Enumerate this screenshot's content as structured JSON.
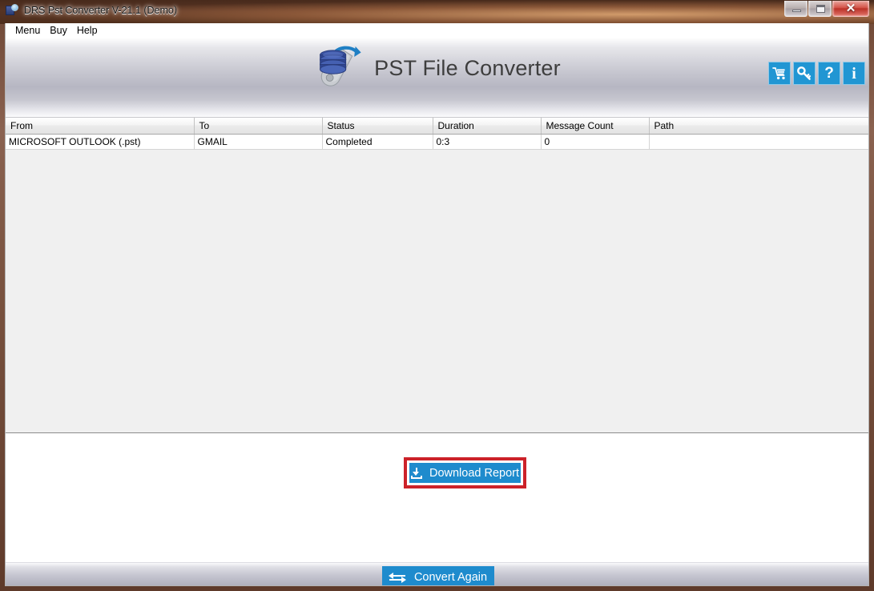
{
  "window": {
    "title": "DRS Pst Converter V-21.1 (Demo)",
    "app_icon": "app-database-icon",
    "controls": {
      "minimize": "minimize-button",
      "maximize": "maximize-button",
      "close_glyph": "✕"
    }
  },
  "menubar": {
    "items": [
      {
        "label": "Menu"
      },
      {
        "label": "Buy"
      },
      {
        "label": "Help"
      }
    ]
  },
  "header": {
    "brand_title": "PST File Converter",
    "logo_icon": "database-wrench-logo",
    "toolbar": [
      {
        "name": "cart-icon",
        "glyph": "",
        "title": "Buy"
      },
      {
        "name": "key-icon",
        "glyph": "",
        "title": "Activate"
      },
      {
        "name": "question-icon",
        "glyph": "?",
        "title": "Help"
      },
      {
        "name": "info-icon",
        "glyph": "i",
        "title": "About"
      }
    ]
  },
  "list": {
    "columns": [
      "From",
      "To",
      "Status",
      "Duration",
      "Message Count",
      "Path"
    ],
    "rows": [
      {
        "from": "MICROSOFT OUTLOOK (.pst)",
        "to": "GMAIL",
        "status": "Completed",
        "duration": "0:3",
        "message_count": "0",
        "path": ""
      }
    ]
  },
  "actions": {
    "download_report_label": "Download Report",
    "download_icon": "download-arrow-icon",
    "convert_again_label": "Convert Again",
    "convert_icon": "swap-arrows-icon"
  },
  "colors": {
    "button_blue": "#1e8bcd",
    "icon_blue": "#2196d3",
    "highlight_red": "#cc2229",
    "list_background": "#f0f0f0"
  }
}
